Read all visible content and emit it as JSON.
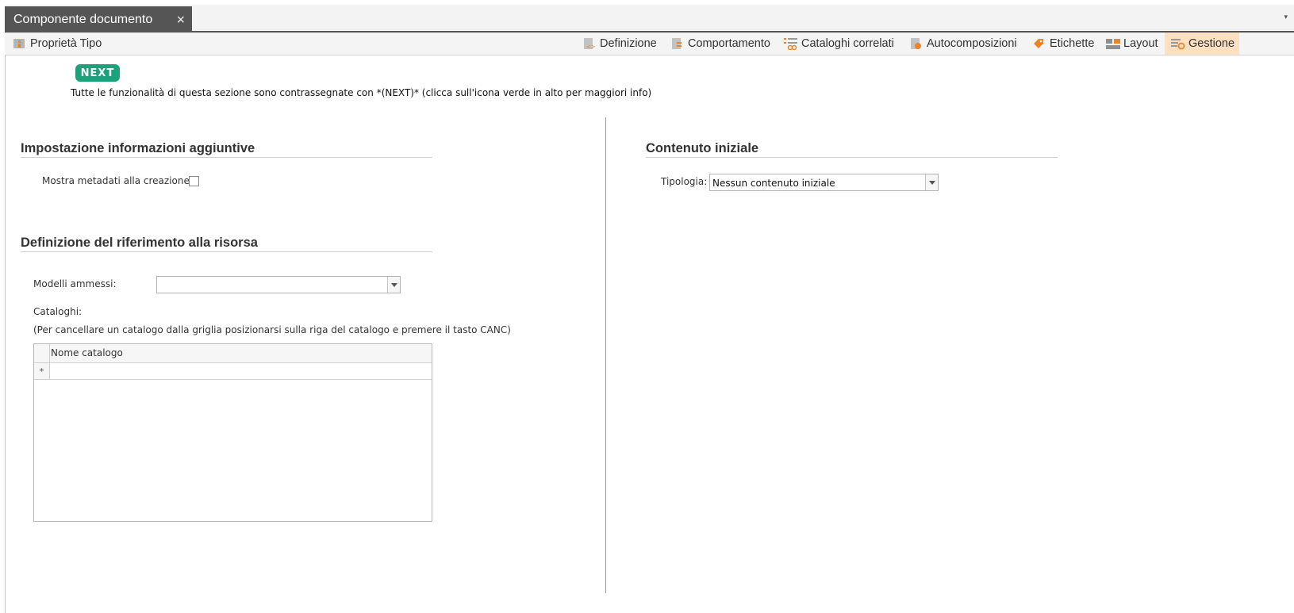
{
  "tab": {
    "title": "Componente documento",
    "close_glyph": "×",
    "menu_glyph": "▾"
  },
  "toolbar": {
    "left": {
      "label": "Proprietà Tipo",
      "icon": "info-icon"
    },
    "items": [
      {
        "label": "Definizione",
        "icon": "definition-icon"
      },
      {
        "label": "Comportamento",
        "icon": "behavior-icon"
      },
      {
        "label": "Cataloghi correlati",
        "icon": "related-catalogs-icon"
      },
      {
        "label": "Autocomposizioni",
        "icon": "autocomposition-icon"
      },
      {
        "label": "Etichette",
        "icon": "tag-icon"
      },
      {
        "label": "Layout",
        "icon": "layout-icon"
      },
      {
        "label": "Gestione",
        "icon": "management-icon",
        "active": true
      }
    ]
  },
  "next": {
    "badge": "NEXT",
    "note": "Tutte le funzionalità di questa sezione sono contrassegnate con *(NEXT)* (clicca sull'icona verde in alto per maggiori info)",
    "color": "#1aa37a"
  },
  "additional_info": {
    "title": "Impostazione informazioni aggiuntive",
    "show_metadata_label": "Mostra metadati alla creazione:",
    "show_metadata_checked": false
  },
  "resource_ref": {
    "title": "Definizione del riferimento alla risorsa",
    "allowed_models_label": "Modelli ammessi:",
    "allowed_models_value": "",
    "catalogs_label": "Cataloghi:",
    "catalogs_hint": "(Per cancellare un catalogo dalla griglia posizionarsi sulla riga del catalogo e premere il tasto CANC)",
    "grid": {
      "column": "Nome catalogo",
      "new_row_marker": "*"
    }
  },
  "initial_content": {
    "title": "Contenuto iniziale",
    "type_label": "Tipologia:",
    "type_value": "Nessun contenuto iniziale"
  },
  "colors": {
    "active_tab_bg": "#fde0c2",
    "accent_orange": "#e8852b",
    "doc_tab_bg": "#555555"
  }
}
